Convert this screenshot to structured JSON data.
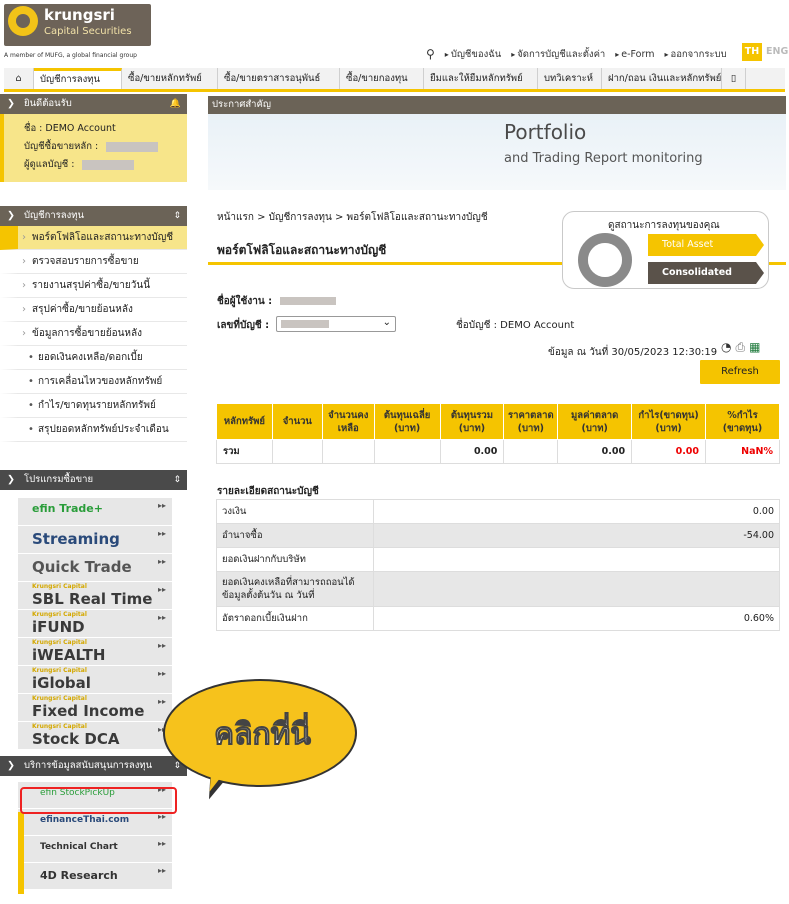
{
  "brand": {
    "name": "krungsri",
    "sub": "Capital Securities",
    "tagline": "A member of MUFG, a global financial group"
  },
  "topnav": [
    "บัญชีของฉัน",
    "จัดการบัญชีและตั้งค่า",
    "e-Form",
    "ออกจากระบบ"
  ],
  "lang": {
    "th": "TH",
    "en": "ENG"
  },
  "menu": [
    "บัญชีการลงทุน",
    "ซื้อ/ขายหลักทรัพย์",
    "ซื้อ/ขายตราสารอนุพันธ์",
    "ซื้อ/ขายกองทุน",
    "ยืมและให้ยืมหลักทรัพย์",
    "บทวิเคราะห์",
    "ฝาก/ถอน เงินและหลักทรัพย์"
  ],
  "welcome": {
    "title": "ยินดีต้อนรับ",
    "name_label": "ชื่อ : DEMO Account",
    "acc_label": "บัญชีซื้อขายหลัก :",
    "owner_label": "ผู้ดูแลบัญชี :"
  },
  "invest": {
    "title": "บัญชีการลงทุน",
    "items": [
      "พอร์ตโฟลิโอและสถานะทางบัญชี",
      "ตรวจสอบรายการซื้อขาย",
      "รายงานสรุปค่าซื้อ/ขายวันนี้",
      "สรุปค่าซื้อ/ขายย้อนหลัง",
      "ข้อมูลการซื้อขายย้อนหลัง"
    ],
    "sub": [
      "ยอดเงินคงเหลือ/ดอกเบี้ย",
      "การเคลื่อนไหวของหลักทรัพย์",
      "กำไร/ขาดทุนรายหลักทรัพย์",
      "สรุปยอดหลักทรัพย์ประจำเดือน"
    ]
  },
  "programs": {
    "title": "โปรแกรมซื้อขาย",
    "items": [
      "efin Trade+",
      "Streaming",
      "Quick Trade",
      "SBL Real Time",
      "iFUND",
      "iWEALTH",
      "iGlobal",
      "Fixed Income",
      "Stock DCA"
    ],
    "small": "Krungsri Capital"
  },
  "support": {
    "title": "บริการข้อมูลสนับสนุนการลงทุน",
    "items": [
      "efin StockPickUp",
      "efinanceThai.com",
      "Technical Chart",
      "4D Research"
    ]
  },
  "announce": "ประกาศสำคัญ",
  "banner": {
    "title": "Portfolio",
    "sub": "and Trading Report monitoring"
  },
  "crumb": "หน้าแรก > บัญชีการลงทุน > พอร์ตโฟลิโอและสถานะทางบัญชี",
  "page_title": "พอร์ตโฟลิโอและสถานะทางบัญชี",
  "status": {
    "title": "ดูสถานะการลงทุนของคุณ",
    "total": "Total Asset",
    "cons": "Consolidated Port"
  },
  "form": {
    "user": "ชื่อผู้ใช้งาน :",
    "acc": "เลขที่บัญชี :",
    "accname": "ชื่อบัญชี : DEMO Account",
    "dataon": "ข้อมูล ณ วันที่ 30/05/2023 12:30:19",
    "refresh": "Refresh"
  },
  "holdings": {
    "headers": [
      "หลักทรัพย์",
      "จำนวน",
      "จำนวนคงเหลือ",
      "ต้นทุนเฉลี่ย (บาท)",
      "ต้นทุนรวม (บาท)",
      "ราคาตลาด (บาท)",
      "มูลค่าตลาด (บาท)",
      "กำไร(ขาดทุน) (บาท)",
      "%กำไร (ขาดทุน)"
    ],
    "total": [
      "รวม",
      "",
      "",
      "",
      "0.00",
      "",
      "0.00",
      "0.00",
      "NaN%"
    ]
  },
  "acct": {
    "title": "รายละเอียดสถานะบัญชี",
    "rows": [
      [
        "วงเงิน",
        "0.00"
      ],
      [
        "อำนาจซื้อ",
        "-54.00"
      ],
      [
        "ยอดเงินฝากกับบริษัท",
        ""
      ],
      [
        "ยอดเงินคงเหลือที่สามารถถอนได้ ข้อมูลตั้งต้นวัน ณ วันที่",
        ""
      ],
      [
        "อัตราดอกเบี้ยเงินฝาก",
        "0.60%"
      ]
    ]
  },
  "callout": "คลิกที่นี่"
}
